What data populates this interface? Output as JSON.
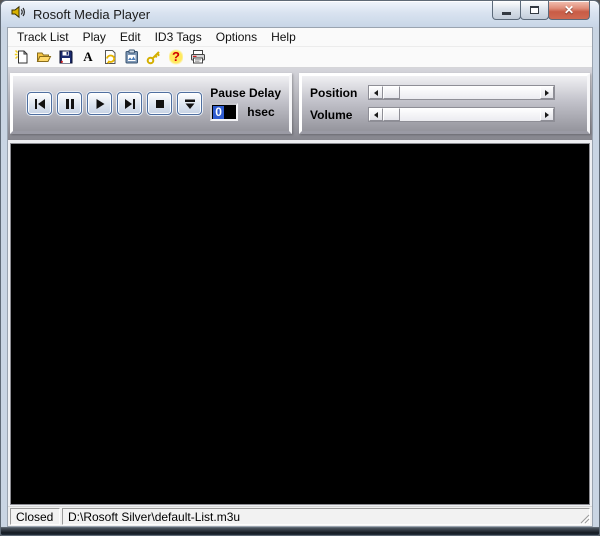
{
  "window": {
    "title": "Rosoft Media Player"
  },
  "menu_bar": {
    "items": [
      {
        "label": "Track List"
      },
      {
        "label": "Play"
      },
      {
        "label": "Edit"
      },
      {
        "label": "ID3 Tags"
      },
      {
        "label": "Options"
      },
      {
        "label": "Help"
      }
    ]
  },
  "toolbar": {
    "icons": [
      {
        "name": "new-playlist-icon"
      },
      {
        "name": "open-playlist-icon"
      },
      {
        "name": "save-playlist-icon"
      },
      {
        "name": "font-icon",
        "glyph": "A"
      },
      {
        "name": "refresh-page-icon"
      },
      {
        "name": "paste-icon"
      },
      {
        "name": "key-icon"
      },
      {
        "name": "help-icon",
        "glyph": "?"
      },
      {
        "name": "print-icon"
      }
    ]
  },
  "controls_panel": {
    "transport": {
      "buttons": [
        {
          "name": "previous-track-button"
        },
        {
          "name": "pause-button"
        },
        {
          "name": "play-button"
        },
        {
          "name": "next-track-button"
        },
        {
          "name": "stop-button"
        },
        {
          "name": "eject-button"
        }
      ]
    },
    "pause_delay": {
      "label": "Pause Delay",
      "value": "0",
      "unit": "hsec"
    },
    "sliders": [
      {
        "label": "Position",
        "thumb_position_pct": 0
      },
      {
        "label": "Volume",
        "thumb_position_pct": 0
      }
    ]
  },
  "status_bar": {
    "state": "Closed",
    "playlist_path": "D:\\Rosoft Silver\\default-List.m3u"
  },
  "colors": {
    "close_button": "#d06a52",
    "selection_blue": "#2e5bcf",
    "panel_light": "#f0f0f3",
    "panel_dark": "#95959d",
    "key_yellow": "#d4af00",
    "help_red": "#d00000"
  }
}
